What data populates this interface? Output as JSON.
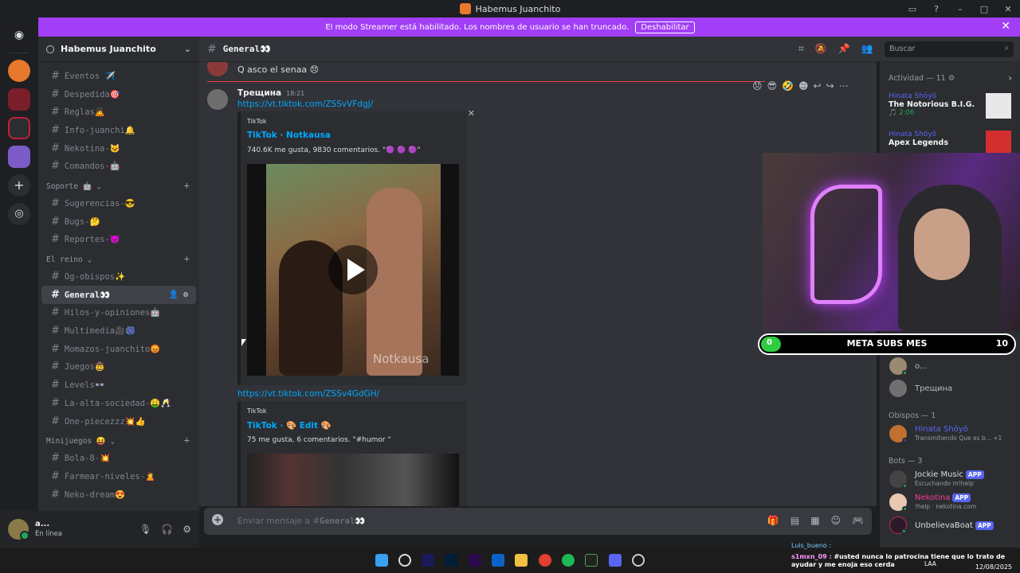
{
  "window": {
    "title": "Habemus Juanchito"
  },
  "streamer_banner": {
    "text": "El modo Streamer está habilitado. Los nombres de usuario se han truncado.",
    "button": "Deshabilitar"
  },
  "server": {
    "name": "Habemus Juanchito"
  },
  "channels_top": [
    {
      "name": "Eventos ✈️"
    },
    {
      "name": "Despedida🎯"
    },
    {
      "name": "Reglas🙇"
    },
    {
      "name": "Info-juanchi🔔"
    },
    {
      "name": "Nekotina-🐱"
    },
    {
      "name": "Comandos-🤖"
    }
  ],
  "cat_soporte": {
    "label": "Soporte 🤖 ⌄"
  },
  "channels_soporte": [
    {
      "name": "Sugerencias-😎"
    },
    {
      "name": "Bugs-🤔"
    },
    {
      "name": "Reportes-👿"
    }
  ],
  "cat_reino": {
    "label": "El reino ⌄"
  },
  "channels_reino": [
    {
      "name": "Og-obispos✨"
    },
    {
      "name": "General👀"
    },
    {
      "name": "Hilos-y-opiniones🤖"
    },
    {
      "name": "Multimedia🎥🎆"
    },
    {
      "name": "Momazos-juanchito😡"
    },
    {
      "name": "Juegos🤠"
    },
    {
      "name": "Levels👓"
    },
    {
      "name": "La-alta-sociedad-🤑🥂"
    },
    {
      "name": "One-piecezzz💥👍"
    }
  ],
  "cat_minijuegos": {
    "label": "Minijuegos 😝 ⌄"
  },
  "channels_minijuegos": [
    {
      "name": "Bola-8-💥"
    },
    {
      "name": "Farmear-niveles-🙎"
    },
    {
      "name": "Neko-dream😍"
    }
  ],
  "user": {
    "name": "a...",
    "status": "En línea"
  },
  "channel_header": {
    "name": "General👀"
  },
  "search": {
    "placeholder": "Buscar"
  },
  "messages": {
    "prev_text": "Q asco el senaa 😞",
    "author": "Трещина",
    "time": "18:21",
    "link1": "https://vt.tiktok.com/ZSSvVFdgJ/",
    "link2": "https://vt.tiktok.com/ZSSv4GdGH/"
  },
  "embed1": {
    "provider": "TikTok",
    "title": "TikTok · Notkausa",
    "desc": "740.6K me gusta, 9830 comentarios. \"🟣 🟣 🟣\"",
    "watermark": "Notkausa"
  },
  "embed2": {
    "provider": "TikTok",
    "title": "TikTok · 🎨 Edit 🎨",
    "desc": "75 me gusta, 6 comentarios. \"#humor \""
  },
  "composer": {
    "prefix": "Enviar mensaje a #",
    "channel": "General👀"
  },
  "activity": {
    "header": "Actividad — 11 ⚙",
    "items": [
      {
        "who": "Hinata Shōyō",
        "what": "The Notorious B.I.G.",
        "sub": "🎵 2:06"
      },
      {
        "who": "Hinata Shōyō",
        "what": "Apex Legends"
      }
    ]
  },
  "members_online": [
    {
      "name": "o..."
    },
    {
      "name": "Трещина"
    }
  ],
  "obispos": {
    "header": "Obispos — 1",
    "member": {
      "name": "Hinata Shōyō",
      "sub": "Transmitiendo Que es b...",
      "extra": "+1"
    }
  },
  "bots": {
    "header": "Bots — 3",
    "items": [
      {
        "name": "Jockie Music",
        "badge": "APP",
        "sub": "Escuchando m!help"
      },
      {
        "name": "Nekotina",
        "badge": "APP",
        "sub": "!help · nekotina.com"
      },
      {
        "name": "UnbelievaBoat",
        "badge": "APP",
        "sub": ""
      }
    ]
  },
  "stream_goal": {
    "label": "META SUBS MES",
    "current": "0",
    "target": "10",
    "progress": 0.08
  },
  "stream_chat": {
    "line1_user": "Luis_bueno :",
    "line2_user": "s1mxn_09 :",
    "line2_text": "#usted nunca lo patrocina tiene que lo trato de ayudar y me enoja eso cerda"
  },
  "system": {
    "lang": "LAA",
    "date": "12/08/2025"
  },
  "colors": {
    "accent": "#5865f2",
    "streamer": "#a13ef6",
    "online": "#23a55a",
    "link": "#00a8fc"
  }
}
